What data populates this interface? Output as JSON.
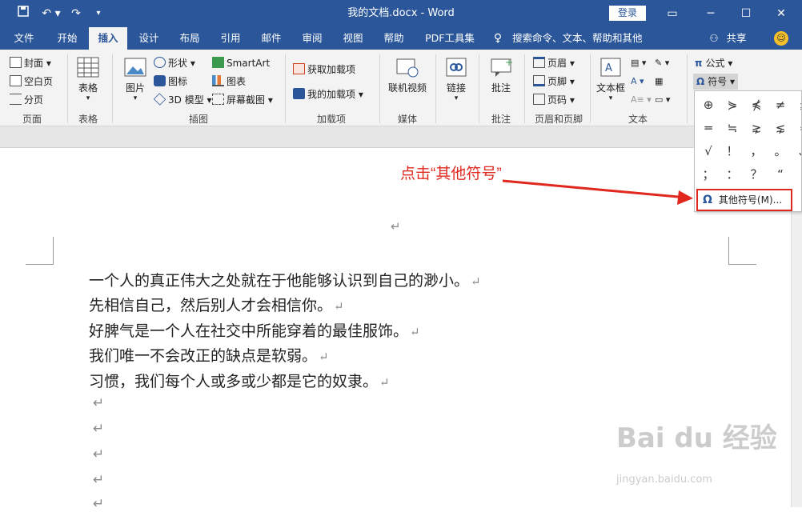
{
  "window": {
    "title": "我的文档.docx - Word",
    "signin_label": "登录"
  },
  "quick_access": {
    "save_icon": "save-icon",
    "undo_icon": "undo-icon",
    "redo_icon": "redo-icon",
    "customize_icon": "customize-icon"
  },
  "window_controls": [
    "restore-ribbon-icon",
    "minimize-icon",
    "maximize-icon",
    "close-icon"
  ],
  "tabs": [
    "文件",
    "开始",
    "插入",
    "设计",
    "布局",
    "引用",
    "邮件",
    "审阅",
    "视图",
    "帮助",
    "PDF工具集"
  ],
  "active_tab": "插入",
  "tell_me": "搜索命令、文本、帮助和其他",
  "share_label": "共享",
  "ribbon": {
    "pages": {
      "cover": "封面",
      "blank": "空白页",
      "break": "分页",
      "group": "页面"
    },
    "tables": {
      "table": "表格",
      "group": "表格"
    },
    "illustrations": {
      "picture": "图片",
      "shapes": "形状",
      "icons": "图标",
      "model3d": "3D 模型",
      "smartart": "SmartArt",
      "chart": "图表",
      "screenshot": "屏幕截图",
      "group": "插图"
    },
    "addins": {
      "get": "获取加载项",
      "my": "我的加载项",
      "group": "加载项"
    },
    "media": {
      "video": "联机视频",
      "group": "媒体"
    },
    "links": {
      "link": "链接",
      "group": ""
    },
    "comments": {
      "comment": "批注",
      "group": "批注"
    },
    "header_footer": {
      "header": "页眉",
      "footer": "页脚",
      "page_number": "页码",
      "group": "页眉和页脚"
    },
    "text": {
      "textbox": "文本框",
      "group": "文本"
    },
    "symbols": {
      "equation": "公式",
      "symbol": "符号"
    }
  },
  "symbol_dropdown": {
    "symbols": [
      "⊕",
      "⋟",
      "⋠",
      "≠",
      "≦",
      "═",
      "≒",
      "⋧",
      "⋦",
      "≈",
      "√",
      "！",
      "，",
      "。",
      "、",
      "；",
      "：",
      "？",
      "“",
      "”"
    ],
    "more_label": "其他符号(M)...",
    "more_icon": "omega-icon"
  },
  "annotation": "点击“其他符号”",
  "document": {
    "paragraphs": [
      "一个人的真正伟大之处就在于他能够认识到自己的渺小。",
      "先相信自己，然后别人才会相信你。",
      "好脾气是一个人在社交中所能穿着的最佳服饰。",
      "我们唯一不会改正的缺点是软弱。",
      "习惯，我们每个人或多或少都是它的奴隶。"
    ],
    "paragraph_mark": "↵",
    "empty_paragraph_count": 5
  },
  "watermark": {
    "text": "Bai du 经验",
    "subtext": "jingyan.baidu.com"
  },
  "colors": {
    "title_bar": "#2b579a",
    "annotation_red": "#e0281f",
    "ribbon_bg": "#f3f3f3"
  }
}
